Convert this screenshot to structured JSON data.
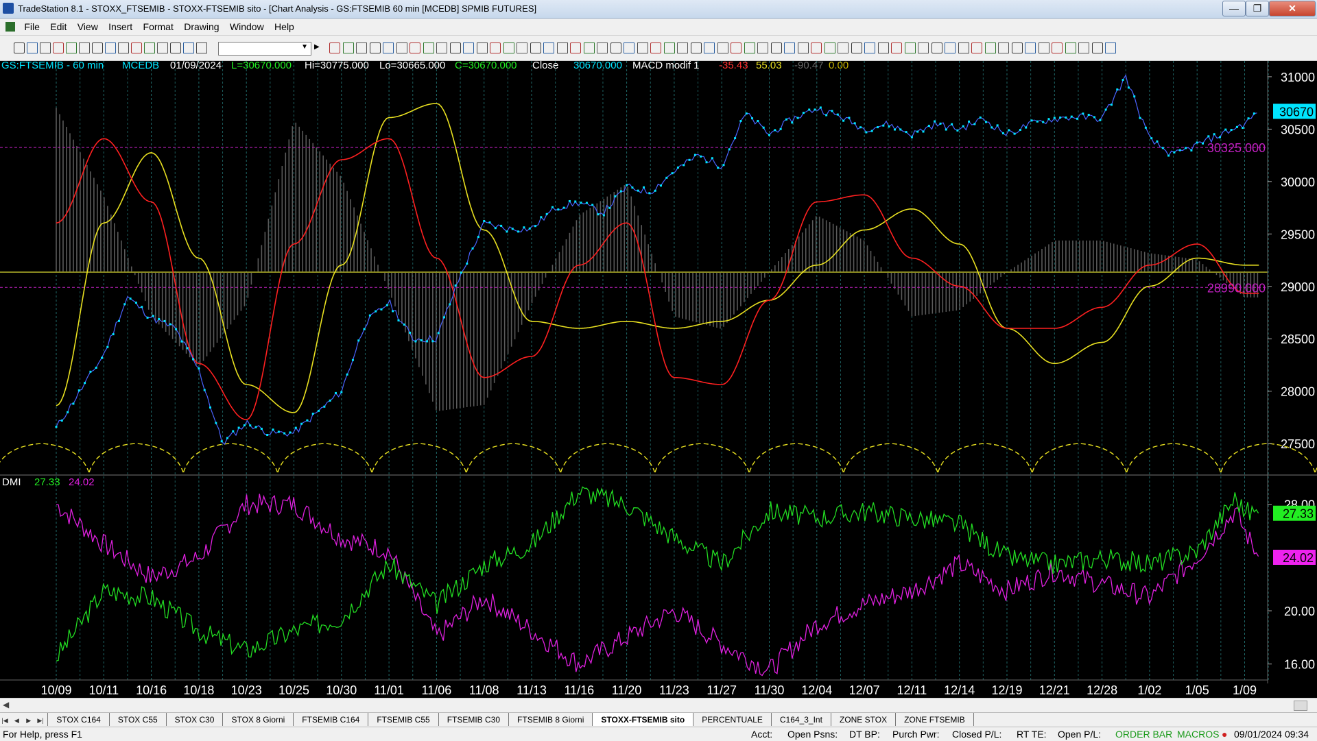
{
  "window": {
    "title": "TradeStation 8.1 - STOXX_FTSEMIB - STOXX-FTSEMIB sito - [Chart Analysis - GS:FTSEMIB  60 min  [MCEDB] SPMIB FUTURES]",
    "minimize_glyph": "—",
    "restore_glyph": "❐",
    "close_glyph": "✕"
  },
  "menu": {
    "items": [
      "File",
      "Edit",
      "View",
      "Insert",
      "Format",
      "Drawing",
      "Window",
      "Help"
    ]
  },
  "mdi": {
    "minimize_glyph": "–",
    "restore_glyph": "❐",
    "close_glyph": "×"
  },
  "chart_header": {
    "symbol": "GS:FTSEMIB - 60 min",
    "study": "MCEDB",
    "date": "01/09/2024",
    "last": "L=30670.000",
    "high": "Hi=30775.000",
    "low": "Lo=30665.000",
    "close": "C=30670.000",
    "close_label": "Close",
    "close_value": "30670.000",
    "indicator": "MACD modif 1",
    "ind_v1": "-35.43",
    "ind_v2": "55.03",
    "ind_v3": "-90.47",
    "ind_v4": "0.00"
  },
  "dmi_header": {
    "name": "DMI",
    "v1": "27.33",
    "v2": "24.02"
  },
  "price_tags": {
    "last": "30670",
    "upper_level": "30325.000",
    "lower_level": "28990.000",
    "dmi_green": "27.33",
    "dmi_magenta": "24.02"
  },
  "colors": {
    "price": "#00e5ff",
    "macd": "#ff2020",
    "signal": "#e8e020",
    "dmi_plus": "#22dd22",
    "dmi_minus": "#e020e0",
    "level": "#c020c0",
    "hist": "#5a5a5a",
    "axis_text": "#ffffff"
  },
  "chart_data": [
    {
      "type": "line",
      "panel": "price",
      "categories": [
        "10/09",
        "10/11",
        "10/16",
        "10/18",
        "10/23",
        "10/25",
        "10/30",
        "11/01",
        "11/06",
        "11/08",
        "11/13",
        "11/16",
        "11/20",
        "11/23",
        "11/27",
        "11/30",
        "12/04",
        "12/07",
        "12/11",
        "12/14",
        "12/19",
        "12/21",
        "12/28",
        "1/02",
        "1/05",
        "1/09"
      ],
      "y_ticks": [
        "31000",
        "30500",
        "30000",
        "29500",
        "29000",
        "28500",
        "28000",
        "27500"
      ],
      "ylim": [
        27200,
        31150
      ],
      "series": [
        {
          "name": "GS:FTSEMIB - 60 min",
          "x": [
            0,
            0.5,
            1,
            1.5,
            2,
            2.5,
            3,
            3.5,
            4,
            4.5,
            5,
            5.5,
            6,
            6.5,
            7,
            7.5,
            8,
            8.5,
            9,
            9.5,
            10,
            10.5,
            11,
            11.5,
            12,
            12.5,
            13,
            13.5,
            14,
            14.5,
            15,
            15.5,
            16,
            16.5,
            17,
            17.5,
            18,
            18.5,
            19,
            19.5,
            20,
            20.5,
            21,
            21.5,
            22,
            22.5,
            23,
            23.5,
            24,
            24.5,
            25,
            25.3
          ],
          "values": [
            27650,
            28000,
            28350,
            28900,
            28700,
            28600,
            28200,
            27500,
            27700,
            27600,
            27600,
            27800,
            28000,
            28650,
            28850,
            28500,
            28500,
            29100,
            29600,
            29550,
            29550,
            29750,
            29800,
            29700,
            29950,
            29900,
            30100,
            30250,
            30150,
            30650,
            30450,
            30600,
            30700,
            30620,
            30500,
            30550,
            30450,
            30550,
            30500,
            30600,
            30450,
            30550,
            30600,
            30620,
            30600,
            31000,
            30400,
            30250,
            30350,
            30450,
            30550,
            30670
          ]
        }
      ]
    },
    {
      "type": "line",
      "panel": "macd",
      "series": [
        {
          "name": "MACD modif 1",
          "x": [
            0,
            1,
            2,
            3,
            4,
            5,
            6,
            7,
            8,
            9,
            10,
            11,
            12,
            13,
            14,
            15,
            16,
            17,
            18,
            19,
            20,
            21,
            22,
            23,
            24,
            25,
            25.3
          ],
          "values": [
            0.35,
            0.95,
            0.5,
            -0.65,
            -1.05,
            0.2,
            0.8,
            0.95,
            0.1,
            -0.75,
            -0.6,
            0.05,
            0.35,
            -0.75,
            -0.8,
            -0.2,
            0.5,
            0.55,
            0.1,
            -0.1,
            -0.4,
            -0.4,
            -0.25,
            0.05,
            0.2,
            -0.15,
            -0.15
          ]
        },
        {
          "name": "",
          "x": [
            0,
            1,
            2,
            3,
            4,
            5,
            6,
            7,
            8,
            9,
            10,
            11,
            12,
            13,
            14,
            15,
            16,
            17,
            18,
            19,
            20,
            21,
            22,
            23,
            24,
            25,
            25.3
          ],
          "values": [
            -0.95,
            0.35,
            0.85,
            0.1,
            -0.8,
            -1.0,
            0.05,
            1.1,
            1.2,
            0.3,
            -0.35,
            -0.4,
            -0.35,
            -0.4,
            -0.35,
            -0.2,
            0.05,
            0.3,
            0.45,
            0.2,
            -0.4,
            -0.65,
            -0.5,
            -0.1,
            0.1,
            0.05,
            0.05
          ]
        }
      ]
    },
    {
      "type": "line",
      "panel": "dmi",
      "y_ticks": [
        "28.00",
        "20.00",
        "16.00"
      ],
      "ylim": [
        14.8,
        30.2
      ],
      "series": [
        {
          "name": "DMI",
          "x": [
            0,
            1,
            2,
            3,
            4,
            5,
            6,
            7,
            8,
            9,
            10,
            11,
            12,
            13,
            14,
            15,
            16,
            17,
            18,
            19,
            20,
            21,
            22,
            23,
            24,
            24.8,
            25,
            25.3
          ],
          "values": [
            16.5,
            21.5,
            21.0,
            18.5,
            17.0,
            18.5,
            19.5,
            23.5,
            20.5,
            23.5,
            25.0,
            29.0,
            28.0,
            25.5,
            23.5,
            27.5,
            27.0,
            27.5,
            27.0,
            26.5,
            24.0,
            23.5,
            24.0,
            23.5,
            24.5,
            28.5,
            27.5,
            27.33
          ]
        },
        {
          "name": "",
          "x": [
            0,
            1,
            2,
            3,
            4,
            5,
            6,
            7,
            8,
            9,
            10,
            11,
            12,
            13,
            14,
            15,
            16,
            17,
            18,
            19,
            20,
            21,
            22,
            23,
            24,
            24.8,
            25,
            25.3
          ],
          "values": [
            28.0,
            25.0,
            22.5,
            24.0,
            28.0,
            28.0,
            25.5,
            24.5,
            18.0,
            21.0,
            18.5,
            16.0,
            18.0,
            20.0,
            17.5,
            15.5,
            19.0,
            20.5,
            21.5,
            23.5,
            21.5,
            23.0,
            22.0,
            21.0,
            24.0,
            27.5,
            26.0,
            24.02
          ]
        }
      ]
    }
  ]
}
